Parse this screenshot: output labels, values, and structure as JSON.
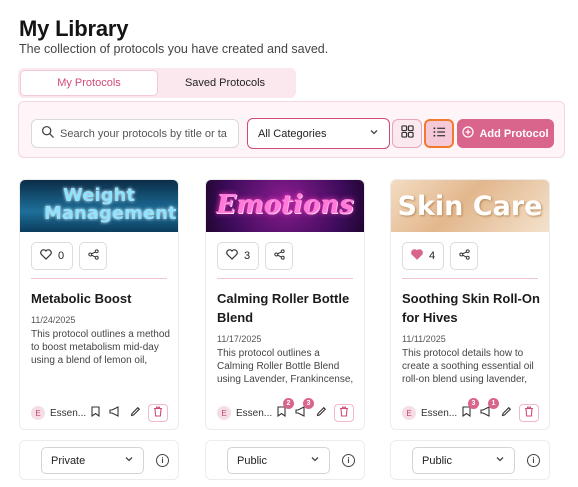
{
  "header": {
    "title": "My Library",
    "subtitle": "The collection of protocols you have created and saved."
  },
  "tabs": [
    {
      "label": "My Protocols",
      "active": true
    },
    {
      "label": "Saved Protocols",
      "active": false
    }
  ],
  "toolbar": {
    "search_placeholder": "Search your protocols by title or ta",
    "category_value": "All Categories",
    "view_mode": "list",
    "add_label": "Add Protocol"
  },
  "colors": {
    "accent": "#d9648c",
    "focus_ring": "#f07b2f"
  },
  "cards": [
    {
      "banner_text": "Weight Management",
      "likes": "0",
      "liked": false,
      "title": "Metabolic Boost",
      "date": "11/24/2025",
      "description": "This protocol outlines a method to boost metabolism mid-day using a blend of lemon oil, castor oil, and...",
      "avatar_initial": "E",
      "author": "Essen...",
      "bookmark_count": "",
      "share_count": "",
      "visibility": "Private"
    },
    {
      "banner_text": "Emotions",
      "likes": "3",
      "liked": false,
      "title": "Calming Roller Bottle Blend",
      "date": "11/17/2025",
      "description": "This protocol outlines a Calming Roller Bottle Blend using Lavender, Frankincense, and Wild Orange...",
      "avatar_initial": "E",
      "author": "Essen...",
      "bookmark_count": "2",
      "share_count": "3",
      "visibility": "Public"
    },
    {
      "banner_text": "Skin Care",
      "likes": "4",
      "liked": true,
      "title": "Soothing Skin Roll-On for Hives",
      "date": "11/11/2025",
      "description": "This protocol details how to create a soothing essential oil roll-on blend using lavender, Roman...",
      "avatar_initial": "E",
      "author": "Essen...",
      "bookmark_count": "3",
      "share_count": "1",
      "visibility": "Public"
    }
  ],
  "icons": {
    "search": "search-icon",
    "chevron": "chevron-down-icon",
    "grid": "grid-view-icon",
    "list": "list-view-icon",
    "add": "plus-circle-icon",
    "like": "heart-icon",
    "share": "share-icon",
    "bookmark": "bookmark-icon",
    "megaphone": "megaphone-icon",
    "edit": "pencil-icon",
    "delete": "trash-icon",
    "info": "info-icon"
  }
}
